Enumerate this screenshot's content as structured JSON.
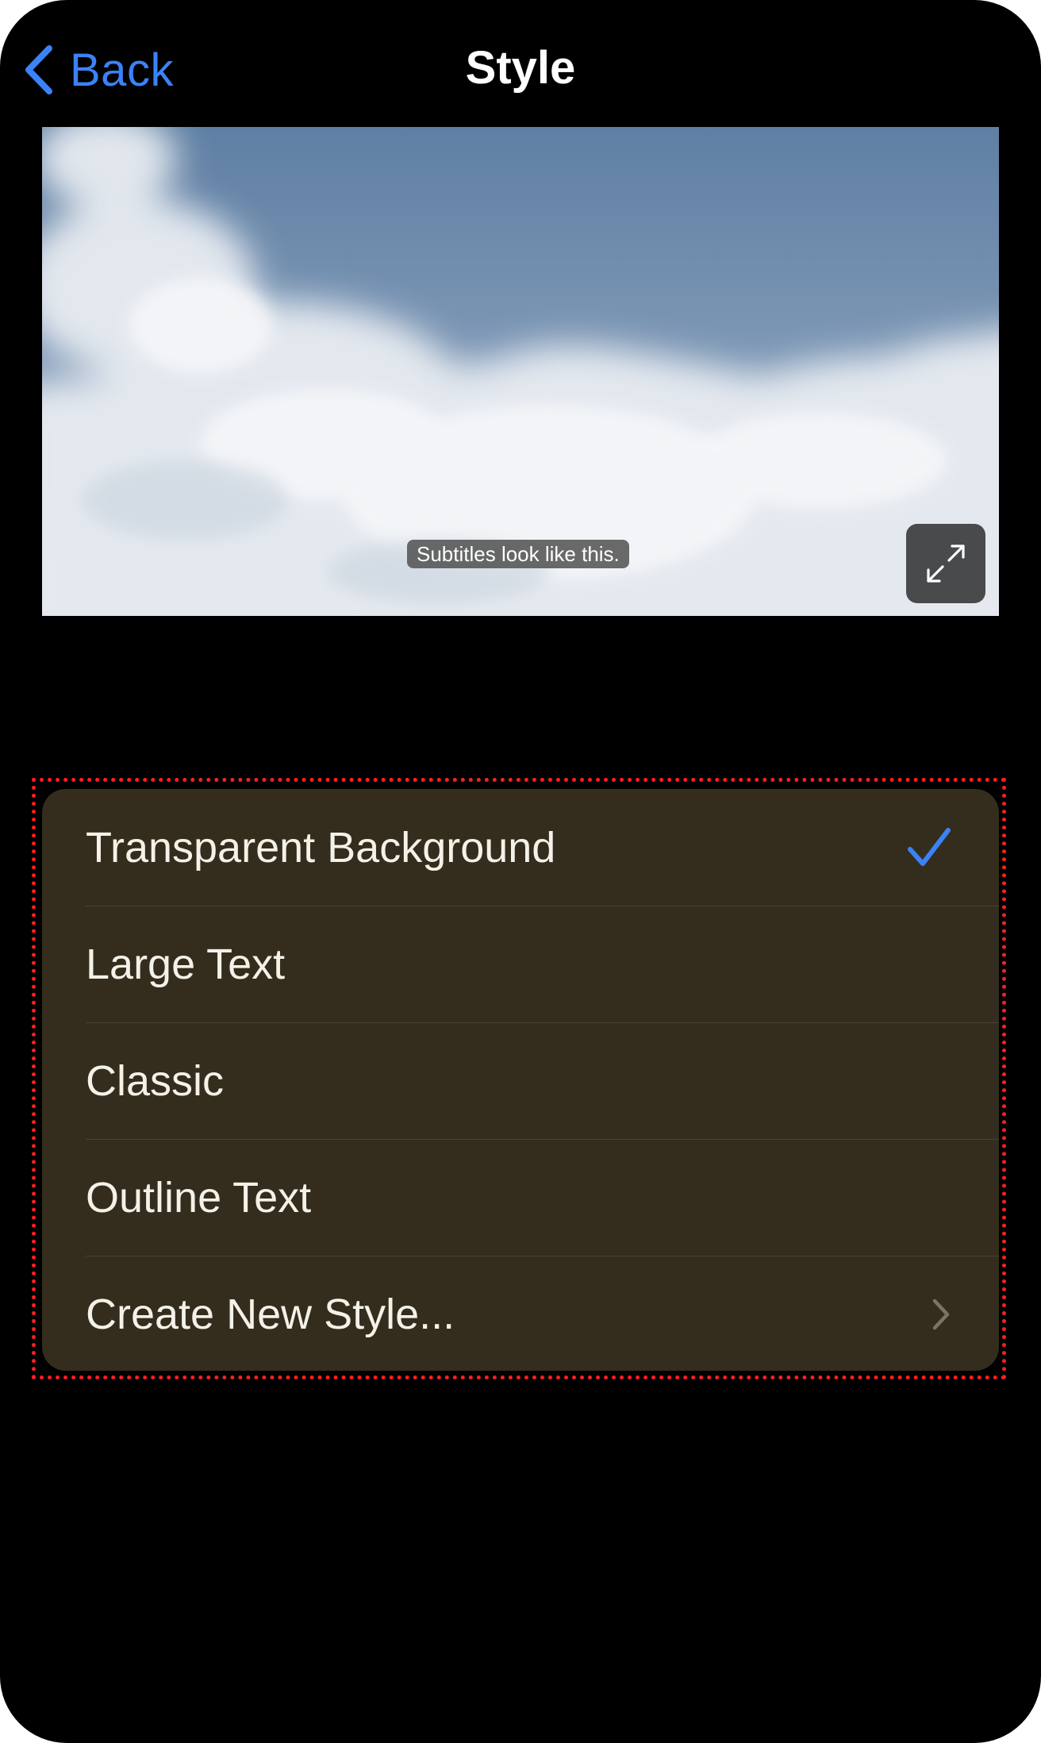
{
  "nav": {
    "back_label": "Back",
    "title": "Style"
  },
  "preview": {
    "subtitle_sample": "Subtitles look like this.",
    "expand_icon": "expand-arrows-icon"
  },
  "options": [
    {
      "label": "Transparent Background",
      "selected": true,
      "accessory": "checkmark-icon"
    },
    {
      "label": "Large Text",
      "selected": false
    },
    {
      "label": "Classic",
      "selected": false
    },
    {
      "label": "Outline Text",
      "selected": false
    },
    {
      "label": "Create New Style...",
      "selected": false,
      "accessory": "chevron-right-icon"
    }
  ],
  "colors": {
    "accent": "#3b82f6",
    "list_background": "#342d1d",
    "highlight_border": "#ff1f1f"
  }
}
